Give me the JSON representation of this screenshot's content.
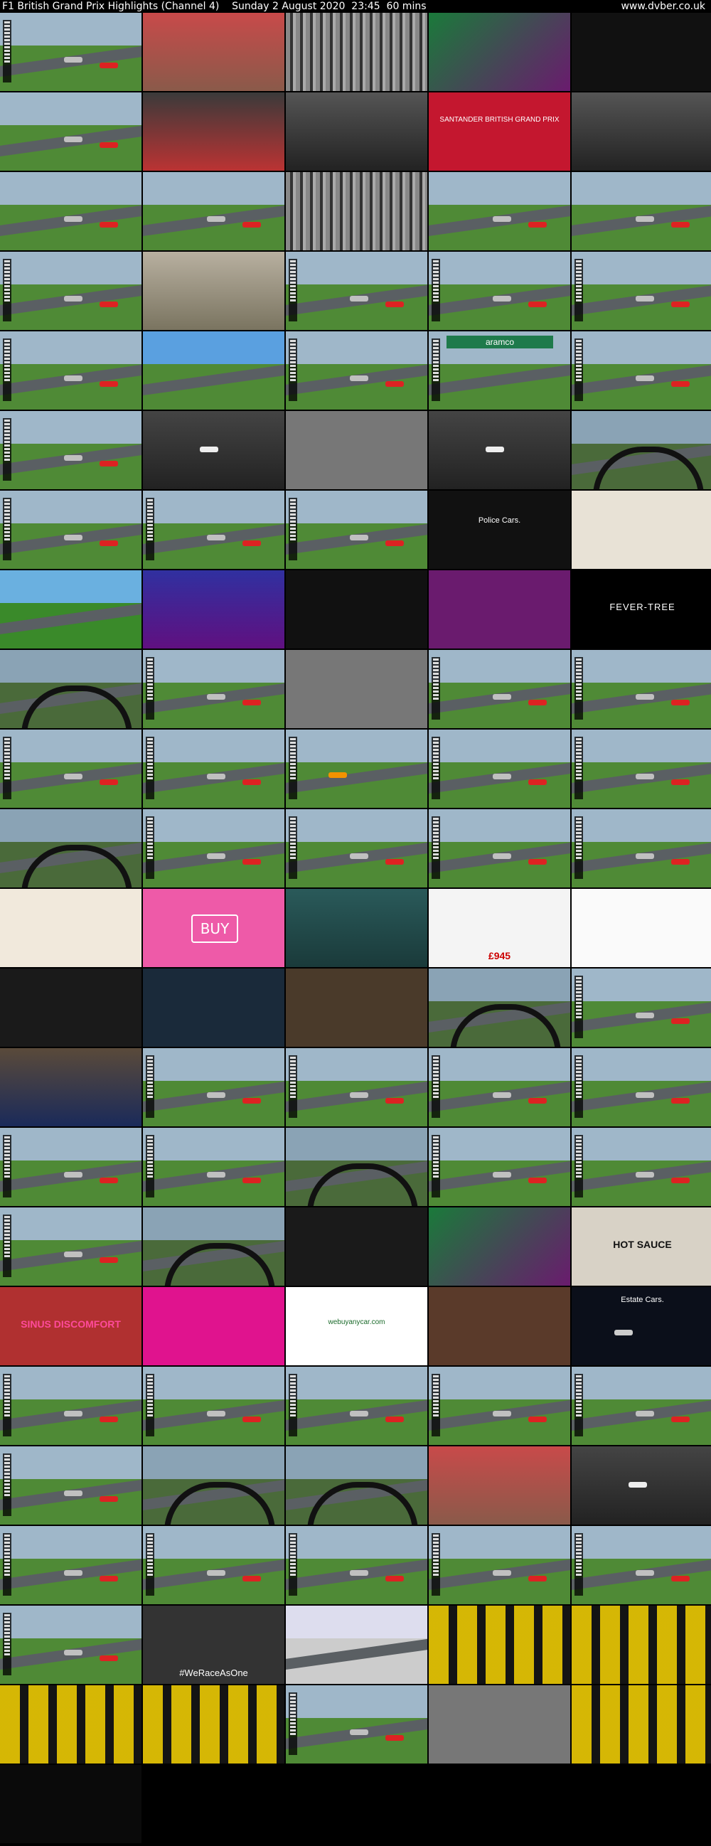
{
  "header": {
    "title": "F1 British Grand Prix Highlights (Channel 4)    Sunday 2 August 2020  23:45  60 mins",
    "site": "www.dvber.co.uk"
  },
  "grid": {
    "columns": 5,
    "rows": 23
  },
  "texts": {
    "police_cars": "Police Cars.",
    "estate_cars": "Estate Cars.",
    "buy": "BUY",
    "fever_tree": "FEVER-TREE",
    "sinus": "SINUS DISCOMFORT",
    "aramco": "aramco",
    "santander": "SANTANDER BRITISH GRAND PRIX",
    "price": "£945",
    "hot_sauce": "HOT SAUCE",
    "webuy": "webuyanycar.com",
    "we_race": "#WeRaceAsOne"
  },
  "colors": {
    "grass": "#4f8a36",
    "sky": "#9fb7c9",
    "pink": "#ee5aa8",
    "magenta": "#e0138e",
    "purple": "#6a1b6e",
    "dark": "#111111"
  }
}
